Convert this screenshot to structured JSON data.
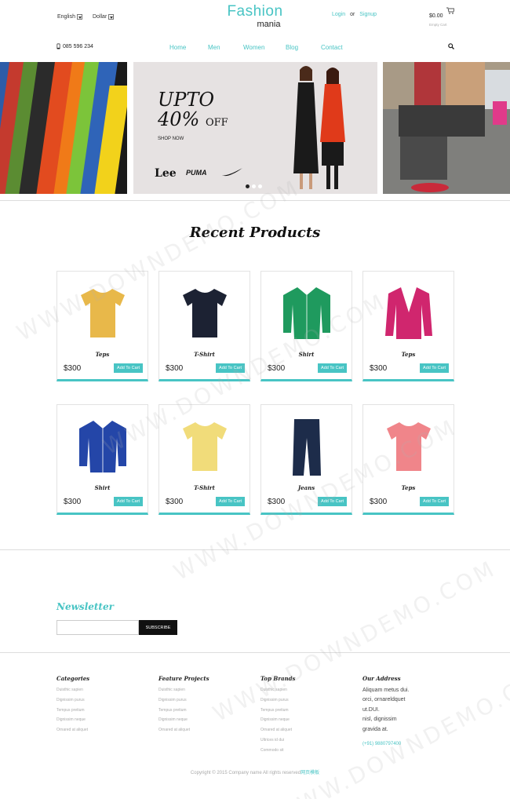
{
  "header": {
    "language": "English",
    "currency": "Dollar",
    "logo_top": "Fashion",
    "logo_bottom": "mania",
    "login": "Login",
    "or": "or",
    "signup": "Signup",
    "cart_total": "$0.00",
    "cart_status": "Empty Cart",
    "phone": "085 596 234"
  },
  "nav": [
    "Home",
    "Men",
    "Women",
    "Blog",
    "Contact"
  ],
  "banner": {
    "headline_1": "UPTO",
    "headline_2": "40%",
    "headline_3": "OFF",
    "cta": "SHOP NOW",
    "brands": [
      "Lee",
      "PUMA"
    ],
    "active_dot": 0
  },
  "products_title": "Recent Products",
  "products": [
    {
      "name": "Teps",
      "price": "$300",
      "cta": "Add To Cart",
      "color": "#e8b84a",
      "kind": "tee"
    },
    {
      "name": "T-Shirt",
      "price": "$300",
      "cta": "Add To Cart",
      "color": "#1c2233",
      "kind": "tee"
    },
    {
      "name": "Shirt",
      "price": "$300",
      "cta": "Add To Cart",
      "color": "#1f9a5e",
      "kind": "shirt"
    },
    {
      "name": "Teps",
      "price": "$300",
      "cta": "Add To Cart",
      "color": "#d0266e",
      "kind": "cardigan"
    },
    {
      "name": "Shirt",
      "price": "$300",
      "cta": "Add To Cart",
      "color": "#2446a8",
      "kind": "shirt"
    },
    {
      "name": "T-Shirt",
      "price": "$300",
      "cta": "Add To Cart",
      "color": "#f1dc7a",
      "kind": "tee"
    },
    {
      "name": "Jeans",
      "price": "$300",
      "cta": "Add To Cart",
      "color": "#1d2c4a",
      "kind": "jeans"
    },
    {
      "name": "Teps",
      "price": "$300",
      "cta": "Add To Cart",
      "color": "#f0858a",
      "kind": "tee"
    }
  ],
  "newsletter": {
    "title": "Newsletter",
    "input_value": "",
    "button": "SUBSCRIBE"
  },
  "footer": {
    "columns": [
      {
        "title": "Categories",
        "items": [
          "Duisthic sapien",
          "Dignissim purus",
          "Tempus pretium",
          "Dignissim neque",
          "Ornared at aliquet"
        ]
      },
      {
        "title": "Feature Projects",
        "items": [
          "Duisthic sapien",
          "Dignissim purus",
          "Tempus pretium",
          "Dignissim neque",
          "Ornared at aliquet"
        ]
      },
      {
        "title": "Top Brands",
        "items": [
          "Duisthic sapien",
          "Dignissim purus",
          "Tempus pretium",
          "Dignissim neque",
          "Ornared at aliquet",
          "Ultrices id dui",
          "Commodo sit"
        ]
      }
    ],
    "address_title": "Our Address",
    "address_lines": [
      "Aliquam metus dui.",
      "orci, ornareldquet",
      "ut.DUI.",
      "nisl, dignissim",
      "gravida at."
    ],
    "phone": "(+91) 9880797400",
    "copyright": "Copyright © 2015 Company name All rights reserved",
    "copyright_link": "网页模板"
  },
  "watermark": "WWW.DOWNDEMO.COM"
}
